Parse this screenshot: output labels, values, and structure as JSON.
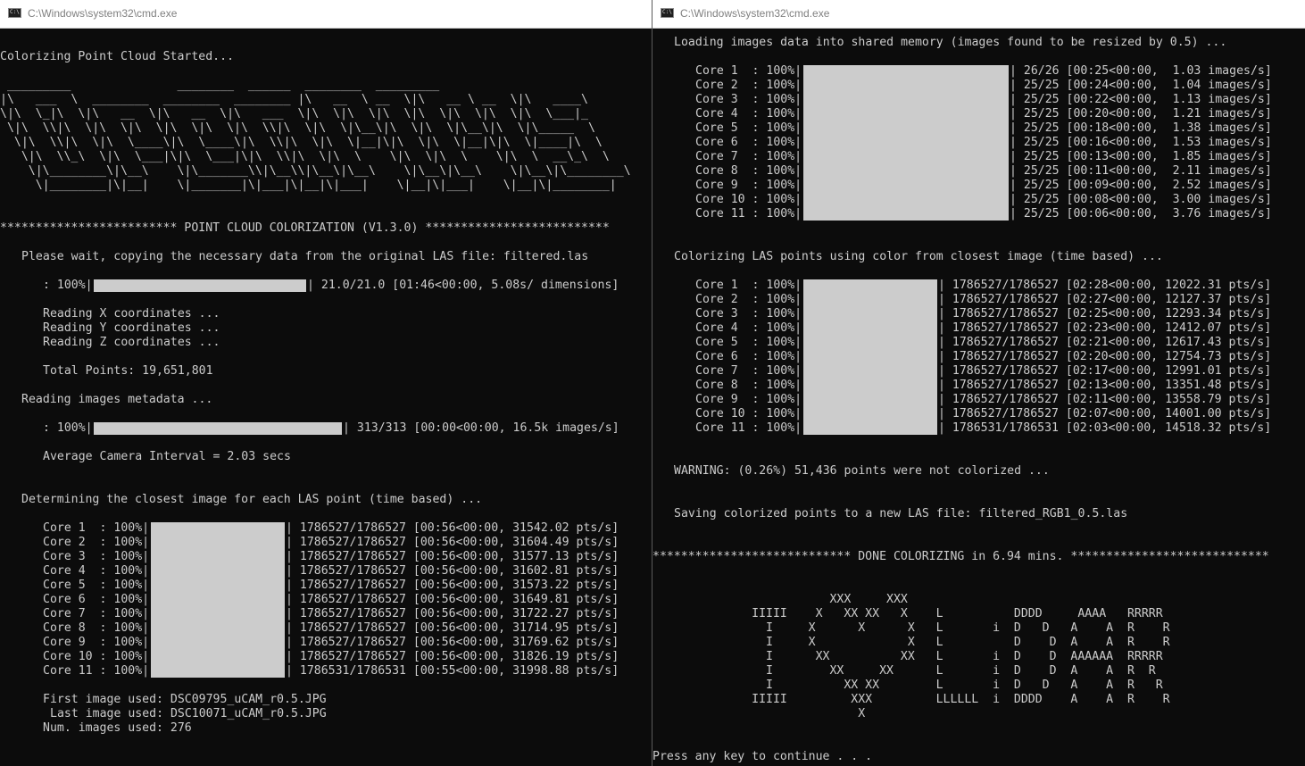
{
  "left_window": {
    "title": "C:\\Windows\\system32\\cmd.exe",
    "lines": [
      {
        "row": 1,
        "col": 0,
        "text": "Colorizing Point Cloud Started..."
      },
      {
        "row": 3,
        "col": 0,
        "text": " _________               ________  ______  ________  _________"
      },
      {
        "row": 4,
        "col": 0,
        "text": "|\\   ___  \\  ________  ________  ________ |\\   __  \\ __  \\|\\   __ \\ __  \\|\\   ____\\"
      },
      {
        "row": 5,
        "col": 0,
        "text": "\\|\\  \\_|\\  \\|\\   __  \\|\\   __  \\|\\   ___  \\|\\  \\|\\  \\|\\  \\|\\  \\|\\  \\|\\  \\|\\  \\___|_"
      },
      {
        "row": 6,
        "col": 0,
        "text": " \\|\\  \\\\|\\  \\|\\  \\|\\  \\|\\  \\|\\  \\|\\  \\\\|\\  \\|\\  \\|\\__\\|\\  \\|\\  \\|\\__\\|\\  \\|\\_____  \\"
      },
      {
        "row": 7,
        "col": 0,
        "text": "  \\|\\  \\\\|\\  \\|\\  \\____\\|\\  \\____\\|\\  \\\\|\\  \\|\\  \\|__|\\|\\  \\|\\  \\|__|\\|\\  \\|____|\\  \\"
      },
      {
        "row": 8,
        "col": 0,
        "text": "   \\|\\  \\\\_\\  \\|\\  \\___|\\|\\  \\___|\\|\\  \\\\|\\  \\|\\  \\    \\|\\  \\|\\  \\    \\|\\  \\  __\\_\\  \\"
      },
      {
        "row": 9,
        "col": 0,
        "text": "    \\|\\________\\|\\__\\    \\|\\_______\\\\|\\__\\\\|\\__\\|\\__\\    \\|\\__\\|\\__\\    \\|\\__\\|\\________\\"
      },
      {
        "row": 10,
        "col": 0,
        "text": "     \\|________|\\|__|    \\|_______|\\|___|\\|__|\\|___|    \\|__|\\|___|    \\|__|\\|________|"
      },
      {
        "row": 13,
        "col": 0,
        "text": "************************* POINT CLOUD COLORIZATION (V1.3.0) **************************"
      },
      {
        "row": 15,
        "col": 3,
        "text": "Please wait, copying the necessary data from the original LAS file: filtered.las"
      },
      {
        "row": 17,
        "col": 6,
        "text": ": 100%|"
      },
      {
        "row": 17,
        "col": 43,
        "text": "| 21.0/21.0 [01:46<00:00, 5.08s/ dimensions]"
      },
      {
        "row": 19,
        "col": 6,
        "text": "Reading X coordinates ..."
      },
      {
        "row": 20,
        "col": 6,
        "text": "Reading Y coordinates ..."
      },
      {
        "row": 21,
        "col": 6,
        "text": "Reading Z coordinates ..."
      },
      {
        "row": 23,
        "col": 6,
        "text": "Total Points: 19,651,801"
      },
      {
        "row": 25,
        "col": 3,
        "text": "Reading images metadata ..."
      },
      {
        "row": 27,
        "col": 6,
        "text": ": 100%|"
      },
      {
        "row": 27,
        "col": 48,
        "text": "| 313/313 [00:00<00:00, 16.5k images/s]"
      },
      {
        "row": 29,
        "col": 6,
        "text": "Average Camera Interval = 2.03 secs"
      },
      {
        "row": 32,
        "col": 3,
        "text": "Determining the closest image for each LAS point (time based) ..."
      },
      {
        "row": 34,
        "col": 6,
        "text": "Core 1  : 100%|"
      },
      {
        "row": 34,
        "col": 40,
        "text": "| 1786527/1786527 [00:56<00:00, 31542.02 pts/s]"
      },
      {
        "row": 35,
        "col": 6,
        "text": "Core 2  : 100%|"
      },
      {
        "row": 35,
        "col": 40,
        "text": "| 1786527/1786527 [00:56<00:00, 31604.49 pts/s]"
      },
      {
        "row": 36,
        "col": 6,
        "text": "Core 3  : 100%|"
      },
      {
        "row": 36,
        "col": 40,
        "text": "| 1786527/1786527 [00:56<00:00, 31577.13 pts/s]"
      },
      {
        "row": 37,
        "col": 6,
        "text": "Core 4  : 100%|"
      },
      {
        "row": 37,
        "col": 40,
        "text": "| 1786527/1786527 [00:56<00:00, 31602.81 pts/s]"
      },
      {
        "row": 38,
        "col": 6,
        "text": "Core 5  : 100%|"
      },
      {
        "row": 38,
        "col": 40,
        "text": "| 1786527/1786527 [00:56<00:00, 31573.22 pts/s]"
      },
      {
        "row": 39,
        "col": 6,
        "text": "Core 6  : 100%|"
      },
      {
        "row": 39,
        "col": 40,
        "text": "| 1786527/1786527 [00:56<00:00, 31649.81 pts/s]"
      },
      {
        "row": 40,
        "col": 6,
        "text": "Core 7  : 100%|"
      },
      {
        "row": 40,
        "col": 40,
        "text": "| 1786527/1786527 [00:56<00:00, 31722.27 pts/s]"
      },
      {
        "row": 41,
        "col": 6,
        "text": "Core 8  : 100%|"
      },
      {
        "row": 41,
        "col": 40,
        "text": "| 1786527/1786527 [00:56<00:00, 31714.95 pts/s]"
      },
      {
        "row": 42,
        "col": 6,
        "text": "Core 9  : 100%|"
      },
      {
        "row": 42,
        "col": 40,
        "text": "| 1786527/1786527 [00:56<00:00, 31769.62 pts/s]"
      },
      {
        "row": 43,
        "col": 6,
        "text": "Core 10 : 100%|"
      },
      {
        "row": 43,
        "col": 40,
        "text": "| 1786527/1786527 [00:56<00:00, 31826.19 pts/s]"
      },
      {
        "row": 44,
        "col": 6,
        "text": "Core 11 : 100%|"
      },
      {
        "row": 44,
        "col": 40,
        "text": "| 1786531/1786531 [00:55<00:00, 31998.88 pts/s]"
      },
      {
        "row": 46,
        "col": 6,
        "text": "First image used: DSC09795_uCAM_r0.5.JPG"
      },
      {
        "row": 47,
        "col": 7,
        "text": "Last image used: DSC10071_uCAM_r0.5.JPG"
      },
      {
        "row": 48,
        "col": 6,
        "text": "Num. images used: 276"
      }
    ],
    "bars": [
      {
        "row": 17,
        "col": 13,
        "cols": 30,
        "progress": 1.0
      },
      {
        "row": 27,
        "col": 13,
        "cols": 35,
        "progress": 1.0
      },
      {
        "row": 34,
        "col": 21,
        "cols": 19,
        "rows": 11,
        "progress": 1.0
      }
    ]
  },
  "right_window": {
    "title": "C:\\Windows\\system32\\cmd.exe",
    "lines": [
      {
        "row": 0,
        "col": 3,
        "text": "Loading images data into shared memory (images found to be resized by 0.5) ..."
      },
      {
        "row": 2,
        "col": 6,
        "text": "Core 1  : 100%|"
      },
      {
        "row": 2,
        "col": 50,
        "text": "| 26/26 [00:25<00:00,  1.03 images/s]"
      },
      {
        "row": 3,
        "col": 6,
        "text": "Core 2  : 100%|"
      },
      {
        "row": 3,
        "col": 50,
        "text": "| 25/25 [00:24<00:00,  1.04 images/s]"
      },
      {
        "row": 4,
        "col": 6,
        "text": "Core 3  : 100%|"
      },
      {
        "row": 4,
        "col": 50,
        "text": "| 25/25 [00:22<00:00,  1.13 images/s]"
      },
      {
        "row": 5,
        "col": 6,
        "text": "Core 4  : 100%|"
      },
      {
        "row": 5,
        "col": 50,
        "text": "| 25/25 [00:20<00:00,  1.21 images/s]"
      },
      {
        "row": 6,
        "col": 6,
        "text": "Core 5  : 100%|"
      },
      {
        "row": 6,
        "col": 50,
        "text": "| 25/25 [00:18<00:00,  1.38 images/s]"
      },
      {
        "row": 7,
        "col": 6,
        "text": "Core 6  : 100%|"
      },
      {
        "row": 7,
        "col": 50,
        "text": "| 25/25 [00:16<00:00,  1.53 images/s]"
      },
      {
        "row": 8,
        "col": 6,
        "text": "Core 7  : 100%|"
      },
      {
        "row": 8,
        "col": 50,
        "text": "| 25/25 [00:13<00:00,  1.85 images/s]"
      },
      {
        "row": 9,
        "col": 6,
        "text": "Core 8  : 100%|"
      },
      {
        "row": 9,
        "col": 50,
        "text": "| 25/25 [00:11<00:00,  2.11 images/s]"
      },
      {
        "row": 10,
        "col": 6,
        "text": "Core 9  : 100%|"
      },
      {
        "row": 10,
        "col": 50,
        "text": "| 25/25 [00:09<00:00,  2.52 images/s]"
      },
      {
        "row": 11,
        "col": 6,
        "text": "Core 10 : 100%|"
      },
      {
        "row": 11,
        "col": 50,
        "text": "| 25/25 [00:08<00:00,  3.00 images/s]"
      },
      {
        "row": 12,
        "col": 6,
        "text": "Core 11 : 100%|"
      },
      {
        "row": 12,
        "col": 50,
        "text": "| 25/25 [00:06<00:00,  3.76 images/s]"
      },
      {
        "row": 15,
        "col": 3,
        "text": "Colorizing LAS points using color from closest image (time based) ..."
      },
      {
        "row": 17,
        "col": 6,
        "text": "Core 1  : 100%|"
      },
      {
        "row": 17,
        "col": 40,
        "text": "| 1786527/1786527 [02:28<00:00, 12022.31 pts/s]"
      },
      {
        "row": 18,
        "col": 6,
        "text": "Core 2  : 100%|"
      },
      {
        "row": 18,
        "col": 40,
        "text": "| 1786527/1786527 [02:27<00:00, 12127.37 pts/s]"
      },
      {
        "row": 19,
        "col": 6,
        "text": "Core 3  : 100%|"
      },
      {
        "row": 19,
        "col": 40,
        "text": "| 1786527/1786527 [02:25<00:00, 12293.34 pts/s]"
      },
      {
        "row": 20,
        "col": 6,
        "text": "Core 4  : 100%|"
      },
      {
        "row": 20,
        "col": 40,
        "text": "| 1786527/1786527 [02:23<00:00, 12412.07 pts/s]"
      },
      {
        "row": 21,
        "col": 6,
        "text": "Core 5  : 100%|"
      },
      {
        "row": 21,
        "col": 40,
        "text": "| 1786527/1786527 [02:21<00:00, 12617.43 pts/s]"
      },
      {
        "row": 22,
        "col": 6,
        "text": "Core 6  : 100%|"
      },
      {
        "row": 22,
        "col": 40,
        "text": "| 1786527/1786527 [02:20<00:00, 12754.73 pts/s]"
      },
      {
        "row": 23,
        "col": 6,
        "text": "Core 7  : 100%|"
      },
      {
        "row": 23,
        "col": 40,
        "text": "| 1786527/1786527 [02:17<00:00, 12991.01 pts/s]"
      },
      {
        "row": 24,
        "col": 6,
        "text": "Core 8  : 100%|"
      },
      {
        "row": 24,
        "col": 40,
        "text": "| 1786527/1786527 [02:13<00:00, 13351.48 pts/s]"
      },
      {
        "row": 25,
        "col": 6,
        "text": "Core 9  : 100%|"
      },
      {
        "row": 25,
        "col": 40,
        "text": "| 1786527/1786527 [02:11<00:00, 13558.79 pts/s]"
      },
      {
        "row": 26,
        "col": 6,
        "text": "Core 10 : 100%|"
      },
      {
        "row": 26,
        "col": 40,
        "text": "| 1786527/1786527 [02:07<00:00, 14001.00 pts/s]"
      },
      {
        "row": 27,
        "col": 6,
        "text": "Core 11 : 100%|"
      },
      {
        "row": 27,
        "col": 40,
        "text": "| 1786531/1786531 [02:03<00:00, 14518.32 pts/s]"
      },
      {
        "row": 30,
        "col": 3,
        "text": "WARNING: (0.26%) 51,436 points were not colorized ..."
      },
      {
        "row": 33,
        "col": 3,
        "text": "Saving colorized points to a new LAS file: filtered_RGB1_0.5.las"
      },
      {
        "row": 36,
        "col": 0,
        "text": "**************************** DONE COLORIZING in 6.94 mins. ****************************"
      },
      {
        "row": 39,
        "col": 0,
        "text": "                         XXX     XXX"
      },
      {
        "row": 40,
        "col": 0,
        "text": "              IIIII    X   XX XX   X    L          DDDD     AAAA   RRRRR"
      },
      {
        "row": 41,
        "col": 0,
        "text": "                I     X      X      X   L       i  D   D   A    A  R    R"
      },
      {
        "row": 42,
        "col": 0,
        "text": "                I     X             X   L          D    D  A    A  R    R"
      },
      {
        "row": 43,
        "col": 0,
        "text": "                I      XX          XX   L       i  D    D  AAAAAA  RRRRR"
      },
      {
        "row": 44,
        "col": 0,
        "text": "                I        XX     XX      L       i  D    D  A    A  R  R"
      },
      {
        "row": 45,
        "col": 0,
        "text": "                I          XX XX        L       i  D   D   A    A  R   R"
      },
      {
        "row": 46,
        "col": 0,
        "text": "              IIIII         XXX         LLLLLL  i  DDDD    A    A  R    R"
      },
      {
        "row": 47,
        "col": 0,
        "text": "                             X"
      },
      {
        "row": 50,
        "col": 0,
        "text": "Press any key to continue . . ."
      }
    ],
    "bars": [
      {
        "row": 2,
        "col": 21,
        "cols": 29,
        "rows": 11,
        "progress": 1.0
      },
      {
        "row": 17,
        "col": 21,
        "cols": 19,
        "rows": 11,
        "progress": 1.0
      }
    ]
  },
  "colors": {
    "console_bg": "#0c0c0c",
    "console_text": "#cccccc",
    "progress_fill": "#cccccc",
    "titlebar_bg": "#ffffff",
    "titlebar_text": "#808080"
  }
}
